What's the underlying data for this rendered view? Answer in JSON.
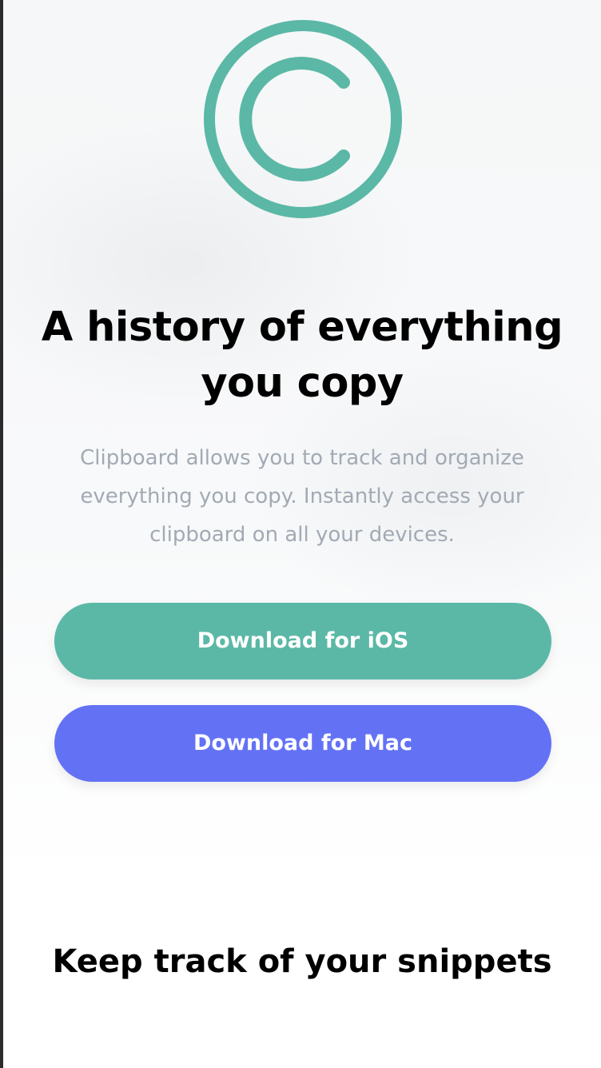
{
  "hero": {
    "logo_icon": "copyright-c-icon",
    "title": "A history of everything you copy",
    "description": "Clipboard allows you to track and organize everything you copy. Instantly access your clipboard on all your devices."
  },
  "buttons": {
    "ios_label": "Download for iOS",
    "mac_label": "Download for Mac"
  },
  "section": {
    "title": "Keep track of your snippets"
  },
  "colors": {
    "accent_green": "#5bb8a6",
    "accent_blue": "#6372f5",
    "muted_text": "#a2aab4",
    "heading_text": "#000000"
  }
}
